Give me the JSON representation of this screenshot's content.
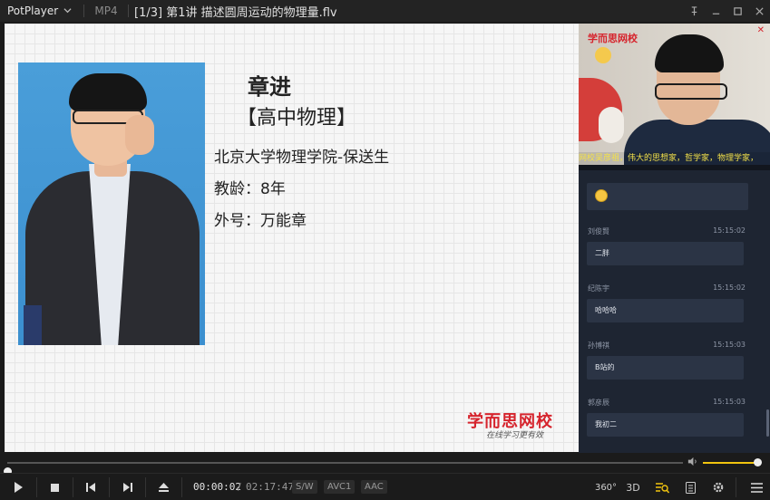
{
  "titlebar": {
    "app_name": "PotPlayer",
    "format": "MP4",
    "title": "[1/3] 第1讲 描述圆周运动的物理量.flv"
  },
  "slide": {
    "name": "章进",
    "subject": "【高中物理】",
    "school": "北京大学物理学院-保送生",
    "years": "教龄：8年",
    "nickname": "外号：万能章",
    "brand": "学而思网校",
    "brand_sub": "在线学习更有效"
  },
  "camera": {
    "logo": "学而思网校",
    "ticker": "网校吴彦祖，伟大的思想家，哲学家，物理学家，"
  },
  "chat": {
    "messages": [
      {
        "user": "刘俊賢",
        "time": "15:15:02",
        "text": "二胖"
      },
      {
        "user": "纪陈宇",
        "time": "15:15:02",
        "text": "哈哈哈"
      },
      {
        "user": "孙博祺",
        "time": "15:15:03",
        "text": "B站的"
      },
      {
        "user": "郭彦辰",
        "time": "15:15:03",
        "text": "我初二"
      }
    ]
  },
  "player": {
    "time_current": "00:00:02",
    "time_separator": "/",
    "time_total": "02:17:47",
    "badges": [
      "S/W",
      "AVC1",
      "AAC"
    ],
    "progress_fraction": 0.0,
    "volume_fraction": 0.97,
    "btn_360": "360°",
    "btn_3d": "3D"
  },
  "colors": {
    "brand_red": "#d6242d",
    "volume_accent": "#f1c40f",
    "chat_bg": "#1e2532",
    "bubble_bg": "#2b3445"
  }
}
